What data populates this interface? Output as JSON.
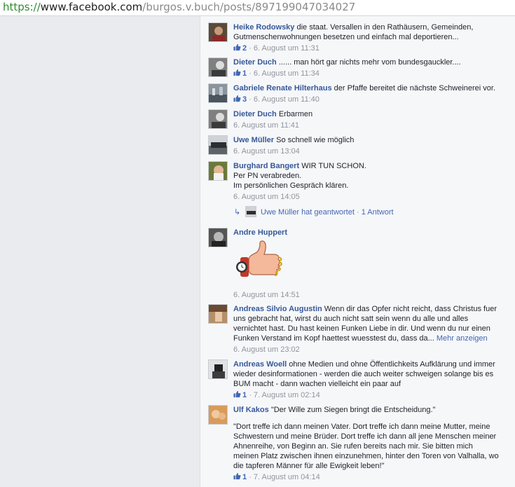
{
  "browser": {
    "url_scheme": "https://",
    "url_host": "www.facebook.com",
    "url_path": "/burgos.v.buch/posts/897199047034027"
  },
  "colors": {
    "link": "#365899",
    "meta": "#90949c",
    "like": "#4267b2"
  },
  "comments": [
    {
      "author": "Heike Rodowsky",
      "text": "die staat. Versallen in den Rathäusern, Gemeinden, Gutmenschenwohnungen besetzen und einfach mal deportieren...",
      "likes": "2",
      "time": "6. August um 11:31"
    },
    {
      "author": "Dieter Duch",
      "text": "...... man hört gar nichts mehr vom bundesgauckler....",
      "likes": "1",
      "time": "6. August um 11:34"
    },
    {
      "author": "Gabriele Renate Hilterhaus",
      "text": "der Pfaffe bereitet die nächste Schweinerei vor.",
      "likes": "3",
      "time": "6. August um 11:40"
    },
    {
      "author": "Dieter Duch",
      "text": "Erbarmen",
      "time": "6. August um 11:41"
    },
    {
      "author": "Uwe Müller",
      "text": "So schnell wie möglich",
      "time": "6. August um 13:04"
    },
    {
      "author": "Burghard Bangert",
      "text_lines": [
        "WIR TUN SCHON.",
        "Per PN verabreden.",
        "Im persönlichen Gespräch klären."
      ],
      "time": "6. August um 14:05",
      "reply": {
        "label": "Uwe Müller hat geantwortet",
        "count": "1 Antwort"
      }
    },
    {
      "author": "Andre Huppert",
      "sticker_icon": "thumbs-up-watch-sticker",
      "time": "6. August um 14:51"
    },
    {
      "author": "Andreas Silvio Augustin",
      "text": "Wenn dir das Opfer nicht reicht, dass Christus fuer uns gebracht hat, wirst du auch nicht satt sein wenn du alle und alles vernichtet hast. Du hast keinen Funken Liebe in dir. Und wenn du nur einen Funken Verstand im Kopf haettest wuesstest du, dass da...",
      "more": "Mehr anzeigen",
      "time": "6. August um 23:02"
    },
    {
      "author": "Andreas Woell",
      "text": "ohne Medien und ohne Öffentlichkeits Aufklärung und immer wieder desinformationen - werden die auch weiter schweigen solange bis es BUM macht - dann wachen vielleicht ein paar auf",
      "likes": "1",
      "time": "7. August um 02:14"
    },
    {
      "author": "Ulf Kakos",
      "text": "\"Der Wille zum Siegen bringt die Entscheidung.\"",
      "quote": "\"Dort treffe ich dann meinen Vater. Dort treffe ich dann meine Mutter, meine Schwestern und meine Brüder. Dort treffe ich dann all jene Menschen meiner Ahnenreihe, von Beginn an. Sie rufen bereits nach mir. Sie bitten mich meinen Platz zwischen ihnen einzunehmen, hinter den Toren von Valhalla, wo die tapferen Männer für alle Ewigkeit leben!\"",
      "likes": "1",
      "time": "7. August um 04:14"
    }
  ]
}
